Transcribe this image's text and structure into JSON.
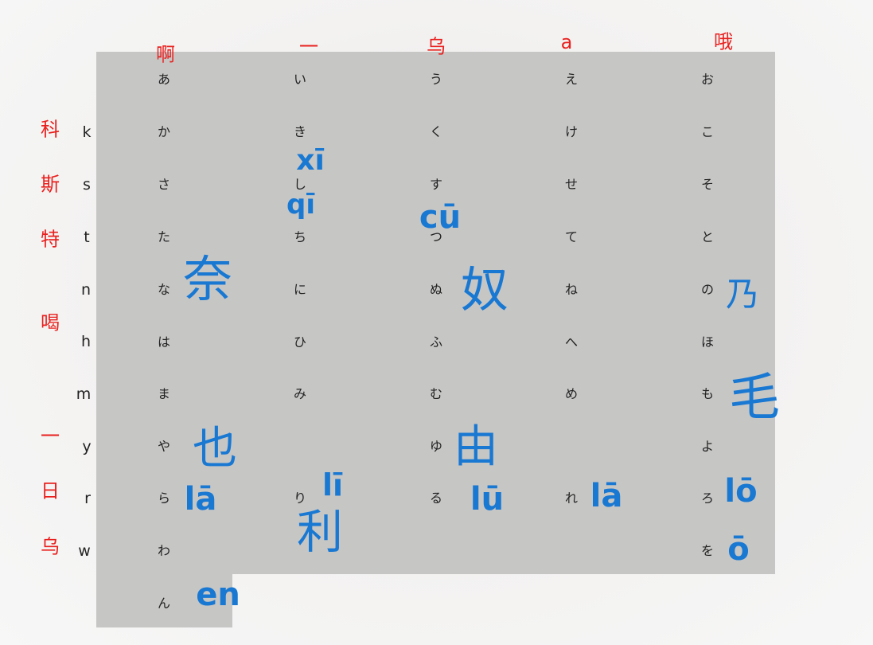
{
  "vowel_headers": [
    "啊",
    "一",
    "乌",
    "a",
    "哦"
  ],
  "row_labels": [
    "k",
    "s",
    "t",
    "n",
    "h",
    "m",
    "y",
    "r",
    "w"
  ],
  "red_row_notes": [
    "科",
    "斯",
    "特",
    "喝",
    "一",
    "日",
    "乌"
  ],
  "kana": {
    "vowels": [
      "あ",
      "い",
      "う",
      "え",
      "お"
    ],
    "k": [
      "か",
      "き",
      "く",
      "け",
      "こ"
    ],
    "s": [
      "さ",
      "し",
      "す",
      "せ",
      "そ"
    ],
    "t": [
      "た",
      "ち",
      "つ",
      "て",
      "と"
    ],
    "n": [
      "な",
      "に",
      "ぬ",
      "ね",
      "の"
    ],
    "h": [
      "は",
      "ひ",
      "ふ",
      "へ",
      "ほ"
    ],
    "m": [
      "ま",
      "み",
      "む",
      "め",
      "も"
    ],
    "y": [
      "や",
      "ゆ",
      "よ"
    ],
    "r": [
      "ら",
      "り",
      "る",
      "れ",
      "ろ"
    ],
    "w": [
      "わ",
      "を"
    ],
    "n_final": "ん"
  },
  "handwriting": {
    "ki": "xī",
    "shi": "qī",
    "su": "cū",
    "na": "奈",
    "nu": "奴",
    "no": "乃",
    "mo": "毛",
    "ya": "也",
    "yu": "由",
    "ra": "lā",
    "ri": "lī",
    "ri_char": "利",
    "ru": "lū",
    "re": "lā",
    "ro": "lō",
    "wo": "ō",
    "n": "en"
  },
  "colors": {
    "red_text": "#e8201e",
    "blue_ink": "#1978d2",
    "panel": "#c6c6c5"
  }
}
